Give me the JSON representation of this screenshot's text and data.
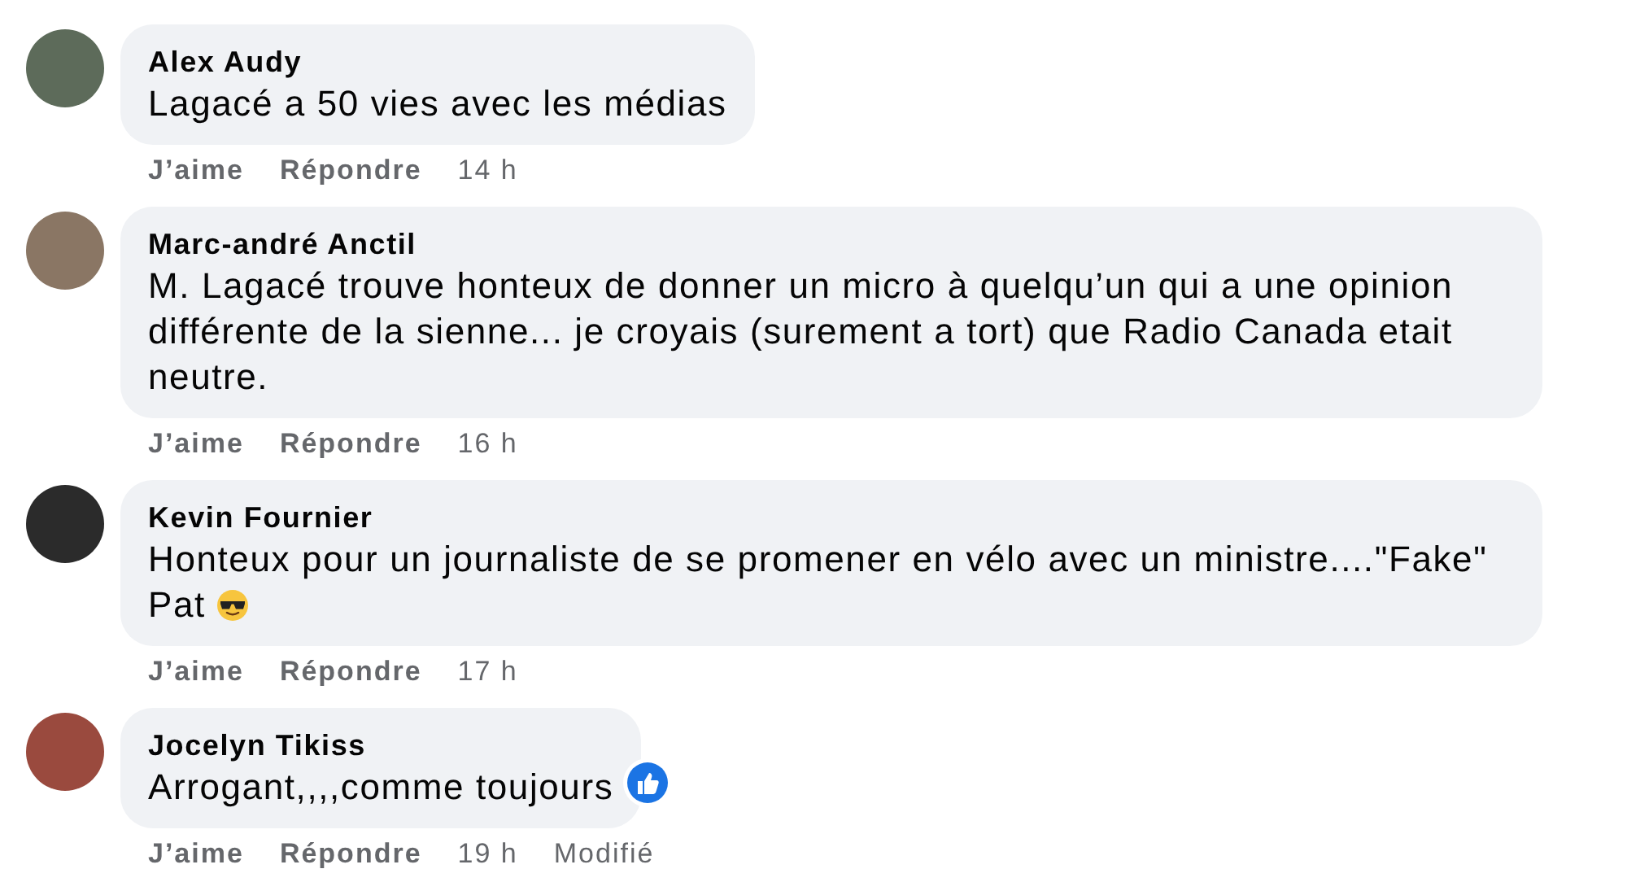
{
  "comments": [
    {
      "author": "Alex Audy",
      "text": "Lagacé a 50 vies avec les médias",
      "actions": [
        "J’aime",
        "Répondre"
      ],
      "time": "14 h"
    },
    {
      "author": "Marc-andré Anctil",
      "text": "M. Lagacé trouve honteux de donner un micro à quelqu’un qui a une opinion différente de la sienne... je croyais (surement a tort) que Radio Canada etait neutre.",
      "actions": [
        "J’aime",
        "Répondre"
      ],
      "time": "16 h"
    },
    {
      "author": "Kevin Fournier",
      "text": "Honteux pour un journaliste de se promener en vélo avec un ministre....\"Fake\" Pat",
      "sunglasses_emoji": true,
      "actions": [
        "J’aime",
        "Répondre"
      ],
      "time": "17 h"
    },
    {
      "author": "Jocelyn Tikiss",
      "text": "Arrogant,,,,comme toujours",
      "like_reaction": true,
      "actions": [
        "J’aime",
        "Répondre"
      ],
      "time": "19 h",
      "edited": "Modifié"
    }
  ]
}
